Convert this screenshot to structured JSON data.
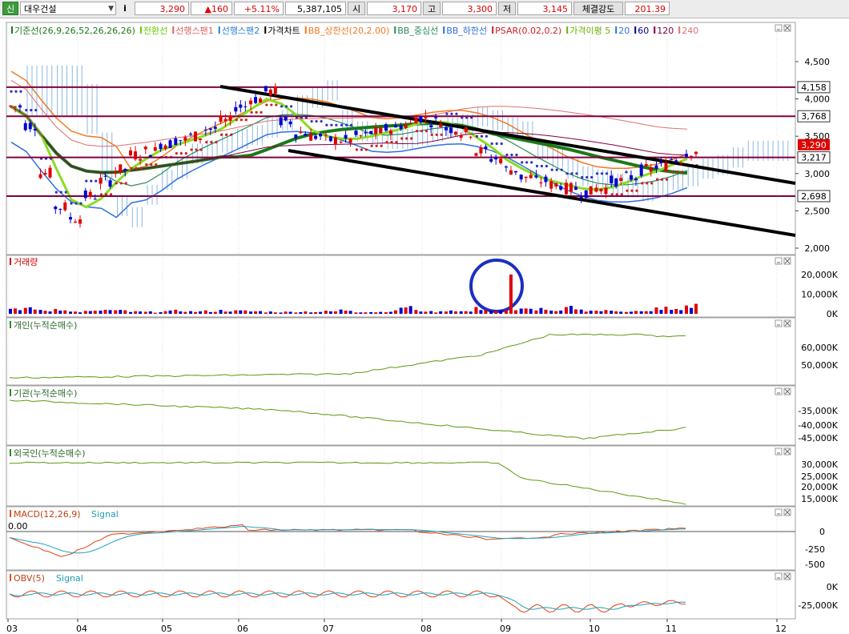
{
  "toolbar": {
    "market_tag": "신",
    "stock_name": "대우건설",
    "dropdown_icon": "chevron-down-icon",
    "info_label": "i",
    "price": "3,290",
    "change": "▲160",
    "change_pct": "+5.11%",
    "volume": "5,387,105",
    "open_label": "시",
    "open_value": "3,170",
    "high_label": "고",
    "high_value": "3,300",
    "low_label": "저",
    "low_value": "3,145",
    "strength_label": "체결강도",
    "strength_value": "201.39",
    "colors": {
      "up": "#e00000",
      "down": "#0000d0"
    }
  },
  "price_panel": {
    "legend": [
      {
        "text": "기준선(26,9,26,52,26,26,26)",
        "color": "#1a7a1a"
      },
      {
        "text": "전환선",
        "color": "#66cc00"
      },
      {
        "text": "선행스팬1",
        "color": "#e06060"
      },
      {
        "text": "선행스팬2",
        "color": "#2f7fd0"
      },
      {
        "text": "가격차트",
        "color": "#000000"
      },
      {
        "text": "BB_상한선(20,2.00)",
        "color": "#f07a20"
      },
      {
        "text": "BB_중심선",
        "color": "#2a8a5a"
      },
      {
        "text": "BB_하한선",
        "color": "#2f6fe0"
      },
      {
        "text": "PSAR(0.02,0.2)",
        "color": "#d02020"
      },
      {
        "text": "가격이평 5",
        "color": "#6ab000"
      },
      {
        "text": "20",
        "color": "#2f6fe0"
      },
      {
        "text": "60",
        "color": "#000080"
      },
      {
        "text": "120",
        "color": "#800040"
      },
      {
        "text": "240",
        "color": "#e07070"
      }
    ],
    "y_ticks": [
      "4,500",
      "4,000",
      "3,500",
      "3,000",
      "2,500",
      "2,000"
    ],
    "levels": [
      "4,158",
      "3,768",
      "3,217",
      "2,698"
    ],
    "current_price": "3,290"
  },
  "volume_panel": {
    "title": "거래량",
    "y_ticks": [
      "20,000K",
      "10,000K",
      "0K"
    ]
  },
  "individual_panel": {
    "title": "개인(누적순매수)",
    "y_ticks": [
      "60,000K",
      "50,000K"
    ]
  },
  "institution_panel": {
    "title": "기관(누적순매수)",
    "y_ticks": [
      "-35,000K",
      "-40,000K",
      "-45,000K"
    ]
  },
  "foreign_panel": {
    "title": "외국인(누적순매수)",
    "y_ticks": [
      "30,000K",
      "25,000K",
      "20,000K",
      "15,000K"
    ]
  },
  "macd_panel": {
    "title": "MACD(12,26,9)",
    "signal": "Signal",
    "zero_label": "0.00",
    "y_ticks": [
      "0",
      "-250",
      "-500"
    ]
  },
  "obv_panel": {
    "title": "OBV(5)",
    "signal": "Signal",
    "y_ticks": [
      "0K",
      "-25,000K"
    ]
  },
  "x_axis": [
    "03",
    "04",
    "05",
    "06",
    "07",
    "08",
    "09",
    "10",
    "11",
    "12"
  ],
  "chart_data": [
    {
      "type": "line",
      "title": "대우건설",
      "series": [
        {
          "name": "가격차트",
          "values": [
            3900,
            3650,
            3000,
            2550,
            2400,
            2700,
            2900,
            3050,
            3250,
            3300,
            3400,
            3450,
            3500,
            3600,
            3700,
            3900,
            4000,
            4100,
            3700,
            3550,
            3500,
            3450,
            3450,
            3500,
            3550,
            3600,
            3650,
            3750,
            3700,
            3600,
            3550,
            3300,
            3200,
            3050,
            2950,
            2900,
            2850,
            2800,
            2750,
            2800,
            2900,
            2950,
            3050,
            3100,
            3200,
            3290
          ]
        }
      ],
      "x": [
        "03",
        "04",
        "05",
        "06",
        "07",
        "08",
        "09",
        "10",
        "11"
      ],
      "ylim": [
        2000,
        4700
      ]
    },
    {
      "type": "bar",
      "series": [
        {
          "name": "거래량",
          "values": [
            2000,
            3000,
            1500,
            2500,
            1000,
            1200,
            1800,
            1500,
            1000,
            900,
            1200,
            1500,
            1100,
            1300,
            1600,
            1400,
            1200,
            1000,
            900,
            1100,
            1000,
            1200,
            1800,
            1000,
            900,
            1300,
            3500,
            1500,
            1000,
            1800,
            1200,
            2600,
            1500,
            20000,
            2200,
            2500,
            1200,
            3000,
            1800,
            1500,
            1500,
            1300,
            1100,
            2800,
            2000,
            4000
          ]
        }
      ],
      "ylim": [
        0,
        22000
      ]
    }
  ]
}
